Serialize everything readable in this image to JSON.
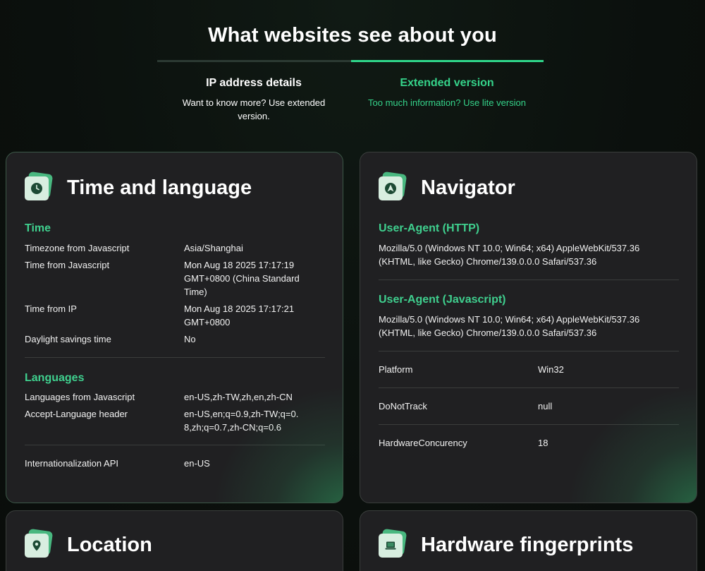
{
  "header": {
    "title": "What websites see about you"
  },
  "tabs": [
    {
      "title": "IP address details",
      "subtitle": "Want to know more? Use extended version."
    },
    {
      "title": "Extended version",
      "subtitle": "Too much information? Use lite version"
    }
  ],
  "colors": {
    "accent": "#2fd68a",
    "card_bg": "#202022",
    "page_bg": "#0b100d"
  },
  "time_language": {
    "title": "Time and language",
    "icon": "clock-icon",
    "time_section": "Time",
    "time_rows": [
      {
        "key": "Timezone from Javascript",
        "value": "Asia/Shanghai"
      },
      {
        "key": "Time from Javascript",
        "value": "Mon Aug 18 2025 17:17:19 GMT+0800 (China Standard Time)"
      },
      {
        "key": "Time from IP",
        "value": "Mon Aug 18 2025 17:17:21 GMT+0800"
      },
      {
        "key": "Daylight savings time",
        "value": "No"
      }
    ],
    "languages_section": "Languages",
    "language_rows": [
      {
        "key": "Languages from Javascript",
        "value": "en-US,zh-TW,zh,en,zh-CN"
      },
      {
        "key": "Accept-Language header",
        "value": "en-US,en;q=0.9,zh-TW;q=0.8,zh;q=0.7,zh-CN;q=0.6"
      }
    ],
    "intl_row": {
      "key": "Internationalization API",
      "value": "en-US"
    }
  },
  "navigator": {
    "title": "Navigator",
    "icon": "navigation-arrow-icon",
    "ua_http_label": "User-Agent (HTTP)",
    "ua_http": "Mozilla/5.0 (Windows NT 10.0; Win64; x64) AppleWebKit/537.36 (KHTML, like Gecko) Chrome/139.0.0.0 Safari/537.36",
    "ua_js_label": "User-Agent (Javascript)",
    "ua_js": "Mozilla/5.0 (Windows NT 10.0; Win64; x64) AppleWebKit/537.36 (KHTML, like Gecko) Chrome/139.0.0.0 Safari/537.36",
    "rows": [
      {
        "key": "Platform",
        "value": "Win32"
      },
      {
        "key": "DoNotTrack",
        "value": "null"
      },
      {
        "key": "HardwareConcurency",
        "value": "18"
      }
    ]
  },
  "location": {
    "title": "Location",
    "icon": "map-pin-icon"
  },
  "hardware": {
    "title": "Hardware fingerprints",
    "icon": "laptop-icon"
  }
}
